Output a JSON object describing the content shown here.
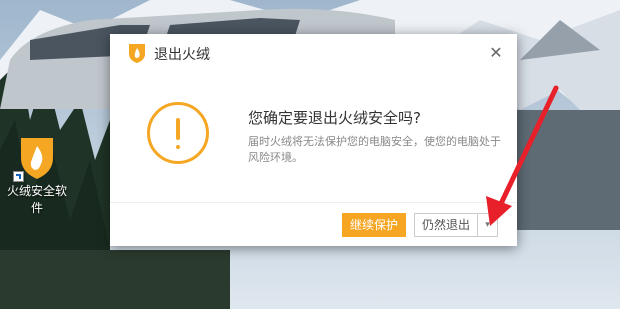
{
  "desktop": {
    "icon_label": "火绒安全软件"
  },
  "dialog": {
    "title": "退出火绒",
    "close_symbol": "✕",
    "heading": "您确定要退出火绒安全吗?",
    "description": "届时火绒将无法保护您的电脑安全，使您的电脑处于风险环境。",
    "primary_button": "继续保护",
    "secondary_button": "仍然退出",
    "dropdown_symbol": "▾"
  },
  "colors": {
    "accent": "#f5a623",
    "annotation_arrow": "#e8202a"
  },
  "icons": [
    "huorong-logo-icon",
    "warning-icon",
    "close-icon",
    "chevron-down-icon",
    "shortcut-arrow-icon"
  ]
}
